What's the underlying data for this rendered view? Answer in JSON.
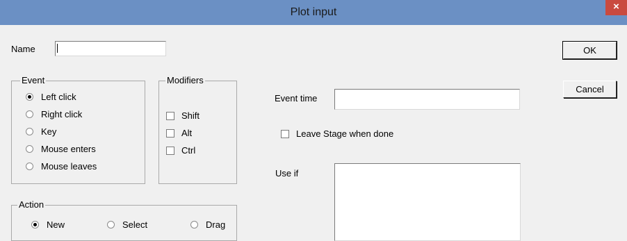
{
  "window": {
    "title": "Plot input",
    "close_glyph": "×"
  },
  "name_field": {
    "label": "Name",
    "value": ""
  },
  "event_group": {
    "title": "Event",
    "options": [
      "Left click",
      "Right click",
      "Key",
      "Mouse enters",
      "Mouse leaves"
    ],
    "selected": "Left click"
  },
  "modifiers_group": {
    "title": "Modifiers",
    "options": [
      "Shift",
      "Alt",
      "Ctrl"
    ]
  },
  "action_group": {
    "title": "Action",
    "options": [
      "New",
      "Select",
      "Drag"
    ],
    "selected": "New"
  },
  "event_time": {
    "label": "Event time",
    "value": ""
  },
  "leave_stage": {
    "label": "Leave Stage when done",
    "checked": false
  },
  "use_if": {
    "label": "Use if",
    "value": ""
  },
  "buttons": {
    "ok": "OK",
    "cancel": "Cancel"
  }
}
